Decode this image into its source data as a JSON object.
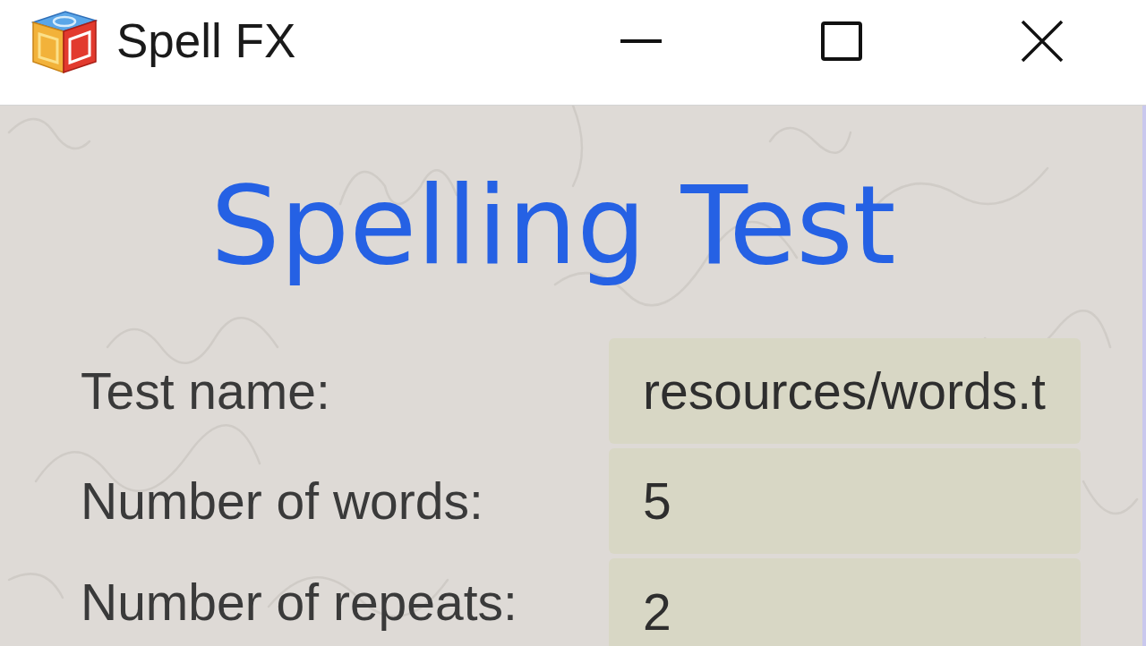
{
  "window": {
    "title": "Spell FX"
  },
  "heading": "Spelling Test",
  "fields": [
    {
      "label": "Test name:",
      "value": "resources/words.t"
    },
    {
      "label": "Number of words:",
      "value": "5"
    },
    {
      "label": "Number of repeats:",
      "value": "2"
    }
  ]
}
